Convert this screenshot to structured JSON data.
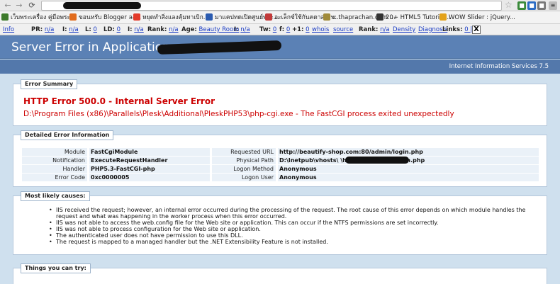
{
  "browser": {
    "url_prefix": "",
    "bookmarks": [
      {
        "label": "เว็บพระเครื่อง คู่มือพระ...",
        "color": "#3d7a2b"
      },
      {
        "label": "ขอนหรับ Blogger ลง...",
        "color": "#e16b1c"
      },
      {
        "label": "หยุดทำสิ่งแลงคุ้มทาเบิก...",
        "color": "#e33b2b"
      },
      {
        "label": "มาแคปทดเปิดศูนย์พระ...",
        "color": "#2b5bb0"
      },
      {
        "label": "อะเล็กซ์ใช้กันคดาสรรพ...",
        "color": "#c23a3a"
      },
      {
        "label": ":: thaprachan.com ...",
        "color": "#a08a3a"
      },
      {
        "label": "20+ HTML5 Tutorial...",
        "color": "#333333"
      },
      {
        "label": "WOW Slider : jQuery...",
        "color": "#e3a21a"
      }
    ]
  },
  "seo_bar": {
    "items": [
      {
        "key": "",
        "value": "Info"
      },
      {
        "key": "PR:",
        "value": "n/a"
      },
      {
        "key": "I:",
        "value": "n/a"
      },
      {
        "key": "L:",
        "value": "0"
      },
      {
        "key": "LD:",
        "value": "0"
      },
      {
        "key": "I:",
        "value": "n/a"
      },
      {
        "key": "Rank:",
        "value": "n/a"
      },
      {
        "key": "Age:",
        "value": "Beauty Room"
      },
      {
        "key": "I:",
        "value": "n/a"
      },
      {
        "key": "Tw:",
        "value": "0"
      },
      {
        "key": "f:",
        "value": "0"
      },
      {
        "key": "+1:",
        "value": "0"
      },
      {
        "key": "",
        "value": "whois"
      },
      {
        "key": "",
        "value": "source"
      },
      {
        "key": "Rank:",
        "value": "n/a"
      },
      {
        "key": "",
        "value": "Density"
      },
      {
        "key": "",
        "value": "Diagnosis"
      },
      {
        "key": "Links:",
        "value": "0 | 2"
      }
    ],
    "close_label": "X"
  },
  "iis": {
    "title": "Server Error in Application",
    "version": "Internet Information Services 7.5",
    "summary": {
      "legend": "Error Summary",
      "heading": "HTTP Error 500.0 - Internal Server Error",
      "message": "D:\\Program Files (x86)\\Parallels\\Plesk\\Additional\\PleskPHP53\\php-cgi.exe - The FastCGI process exited unexpectedly"
    },
    "detail": {
      "legend": "Detailed Error Information",
      "left": [
        {
          "label": "Module",
          "value": "FastCgiModule"
        },
        {
          "label": "Notification",
          "value": "ExecuteRequestHandler"
        },
        {
          "label": "Handler",
          "value": "PHP5.3-FastCGI-php"
        },
        {
          "label": "Error Code",
          "value": "0xc0000005"
        }
      ],
      "right": [
        {
          "label": "Requested URL",
          "value": "http://beautify-shop.com:80/admin/login.php"
        },
        {
          "label": "Physical Path",
          "value": "D:\\Inetpub\\vhosts\\                              \\httpdocs\\admin\\login.php"
        },
        {
          "label": "Logon Method",
          "value": "Anonymous"
        },
        {
          "label": "Logon User",
          "value": "Anonymous"
        }
      ]
    },
    "causes": {
      "legend": "Most likely causes:",
      "items": [
        "IIS received the request; however, an internal error occurred during the processing of the request. The root cause of this error depends on which module handles the request and what was happening in the worker process when this error occurred.",
        "IIS was not able to access the web.config file for the Web site or application. This can occur if the NTFS permissions are set incorrectly.",
        "IIS was not able to process configuration for the Web site or application.",
        "The authenticated user does not have permission to use this DLL.",
        "The request is mapped to a managed handler but the .NET Extensibility Feature is not installed."
      ]
    },
    "try": {
      "legend": "Things you can try:"
    }
  }
}
